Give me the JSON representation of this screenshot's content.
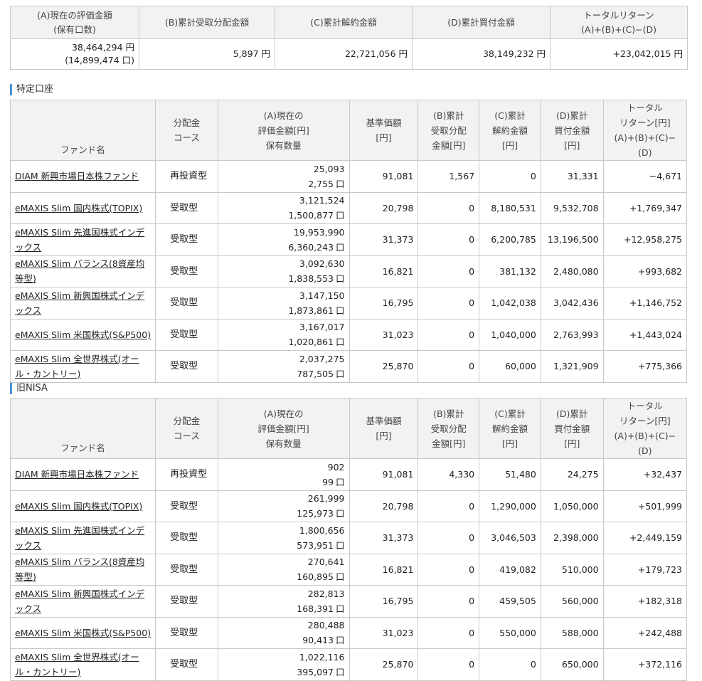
{
  "summary": {
    "headers": {
      "a": "(A)現在の評価金額\n(保有口数)",
      "b": "(B)累計受取分配金額",
      "c": "(C)累計解約金額",
      "d": "(D)累計買付金額",
      "e": "トータルリターン\n(A)+(B)+(C)−(D)"
    },
    "a_value": "38,464,294 円",
    "a_units": "(14,899,474 口)",
    "b_value": "5,897 円",
    "c_value": "22,721,056 円",
    "d_value": "38,149,232 円",
    "e_value": "+23,042,015 円"
  },
  "headers": {
    "fund": "ファンド名",
    "course": "分配金\nコース",
    "a": "(A)現在の\n評価金額[円]\n保有数量",
    "nav": "基準価額\n[円]",
    "b": "(B)累計\n受取分配\n金額[円]",
    "c": "(C)累計\n解約金額\n[円]",
    "d": "(D)累計\n買付金額\n[円]",
    "tr": "トータル\nリターン[円]\n(A)+(B)+(C)−(D)"
  },
  "unit_kou": "口",
  "sections": [
    {
      "title": "特定口座",
      "rows": [
        {
          "fund": "DIAM 新興市場日本株ファンド",
          "course": "再投資型",
          "a_value": "25,093",
          "a_units": "2,755",
          "nav": "91,081",
          "b": "1,567",
          "c": "0",
          "d": "31,331",
          "tr": "−4,671",
          "tr_sign": "minus"
        },
        {
          "fund": "eMAXIS Slim 国内株式(TOPIX)",
          "course": "受取型",
          "a_value": "3,121,524",
          "a_units": "1,500,877",
          "nav": "20,798",
          "b": "0",
          "c": "8,180,531",
          "d": "9,532,708",
          "tr": "+1,769,347",
          "tr_sign": "plus"
        },
        {
          "fund": "eMAXIS Slim 先進国株式インデックス",
          "course": "受取型",
          "a_value": "19,953,990",
          "a_units": "6,360,243",
          "nav": "31,373",
          "b": "0",
          "c": "6,200,785",
          "d": "13,196,500",
          "tr": "+12,958,275",
          "tr_sign": "plus"
        },
        {
          "fund": "eMAXIS Slim バランス(8資産均等型)",
          "course": "受取型",
          "a_value": "3,092,630",
          "a_units": "1,838,553",
          "nav": "16,821",
          "b": "0",
          "c": "381,132",
          "d": "2,480,080",
          "tr": "+993,682",
          "tr_sign": "plus"
        },
        {
          "fund": "eMAXIS Slim 新興国株式インデックス",
          "course": "受取型",
          "a_value": "3,147,150",
          "a_units": "1,873,861",
          "nav": "16,795",
          "b": "0",
          "c": "1,042,038",
          "d": "3,042,436",
          "tr": "+1,146,752",
          "tr_sign": "plus"
        },
        {
          "fund": "eMAXIS Slim 米国株式(S&P500)",
          "course": "受取型",
          "a_value": "3,167,017",
          "a_units": "1,020,861",
          "nav": "31,023",
          "b": "0",
          "c": "1,040,000",
          "d": "2,763,993",
          "tr": "+1,443,024",
          "tr_sign": "plus"
        },
        {
          "fund": "eMAXIS Slim 全世界株式(オール・カントリー)",
          "course": "受取型",
          "a_value": "2,037,275",
          "a_units": "787,505",
          "nav": "25,870",
          "b": "0",
          "c": "60,000",
          "d": "1,321,909",
          "tr": "+775,366",
          "tr_sign": "plus"
        }
      ]
    },
    {
      "title": "旧NISA",
      "rows": [
        {
          "fund": "DIAM 新興市場日本株ファンド",
          "course": "再投資型",
          "a_value": "902",
          "a_units": "99",
          "nav": "91,081",
          "b": "4,330",
          "c": "51,480",
          "d": "24,275",
          "tr": "+32,437",
          "tr_sign": "plus"
        },
        {
          "fund": "eMAXIS Slim 国内株式(TOPIX)",
          "course": "受取型",
          "a_value": "261,999",
          "a_units": "125,973",
          "nav": "20,798",
          "b": "0",
          "c": "1,290,000",
          "d": "1,050,000",
          "tr": "+501,999",
          "tr_sign": "plus"
        },
        {
          "fund": "eMAXIS Slim 先進国株式インデックス",
          "course": "受取型",
          "a_value": "1,800,656",
          "a_units": "573,951",
          "nav": "31,373",
          "b": "0",
          "c": "3,046,503",
          "d": "2,398,000",
          "tr": "+2,449,159",
          "tr_sign": "plus"
        },
        {
          "fund": "eMAXIS Slim バランス(8資産均等型)",
          "course": "受取型",
          "a_value": "270,641",
          "a_units": "160,895",
          "nav": "16,821",
          "b": "0",
          "c": "419,082",
          "d": "510,000",
          "tr": "+179,723",
          "tr_sign": "plus"
        },
        {
          "fund": "eMAXIS Slim 新興国株式インデックス",
          "course": "受取型",
          "a_value": "282,813",
          "a_units": "168,391",
          "nav": "16,795",
          "b": "0",
          "c": "459,505",
          "d": "560,000",
          "tr": "+182,318",
          "tr_sign": "plus"
        },
        {
          "fund": "eMAXIS Slim 米国株式(S&P500)",
          "course": "受取型",
          "a_value": "280,488",
          "a_units": "90,413",
          "nav": "31,023",
          "b": "0",
          "c": "550,000",
          "d": "588,000",
          "tr": "+242,488",
          "tr_sign": "plus"
        },
        {
          "fund": "eMAXIS Slim 全世界株式(オール・カントリー)",
          "course": "受取型",
          "a_value": "1,022,116",
          "a_units": "395,097",
          "nav": "25,870",
          "b": "0",
          "c": "0",
          "d": "650,000",
          "tr": "+372,116",
          "tr_sign": "plus"
        }
      ]
    }
  ]
}
